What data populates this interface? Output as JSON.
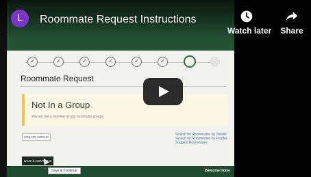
{
  "player": {
    "channel_initial": "L",
    "title": "Roommate Request Instructions",
    "watch_later_label": "Watch later",
    "share_label": "Share",
    "avatar_color": "#7b35c8"
  },
  "frame": {
    "request_title": "Roommate Request",
    "group_title": "Not In a Group",
    "group_subtitle": "You are not a member of any roommate groups.",
    "create_group_label": "CREATE GROUP",
    "links": [
      "Search for Roommates by Details",
      "Search for Roommates by Profiles",
      "Suggest Roommates"
    ],
    "save_button_label": "SAVE & CONTINUE",
    "tooltip": "Save & Continue",
    "footer_text": "Welcome Home",
    "steps": [
      "done",
      "done",
      "done",
      "done",
      "done",
      "done",
      "current",
      "future"
    ],
    "colors": {
      "header_green": "#245235",
      "accent_yellow": "#f0c844"
    }
  }
}
